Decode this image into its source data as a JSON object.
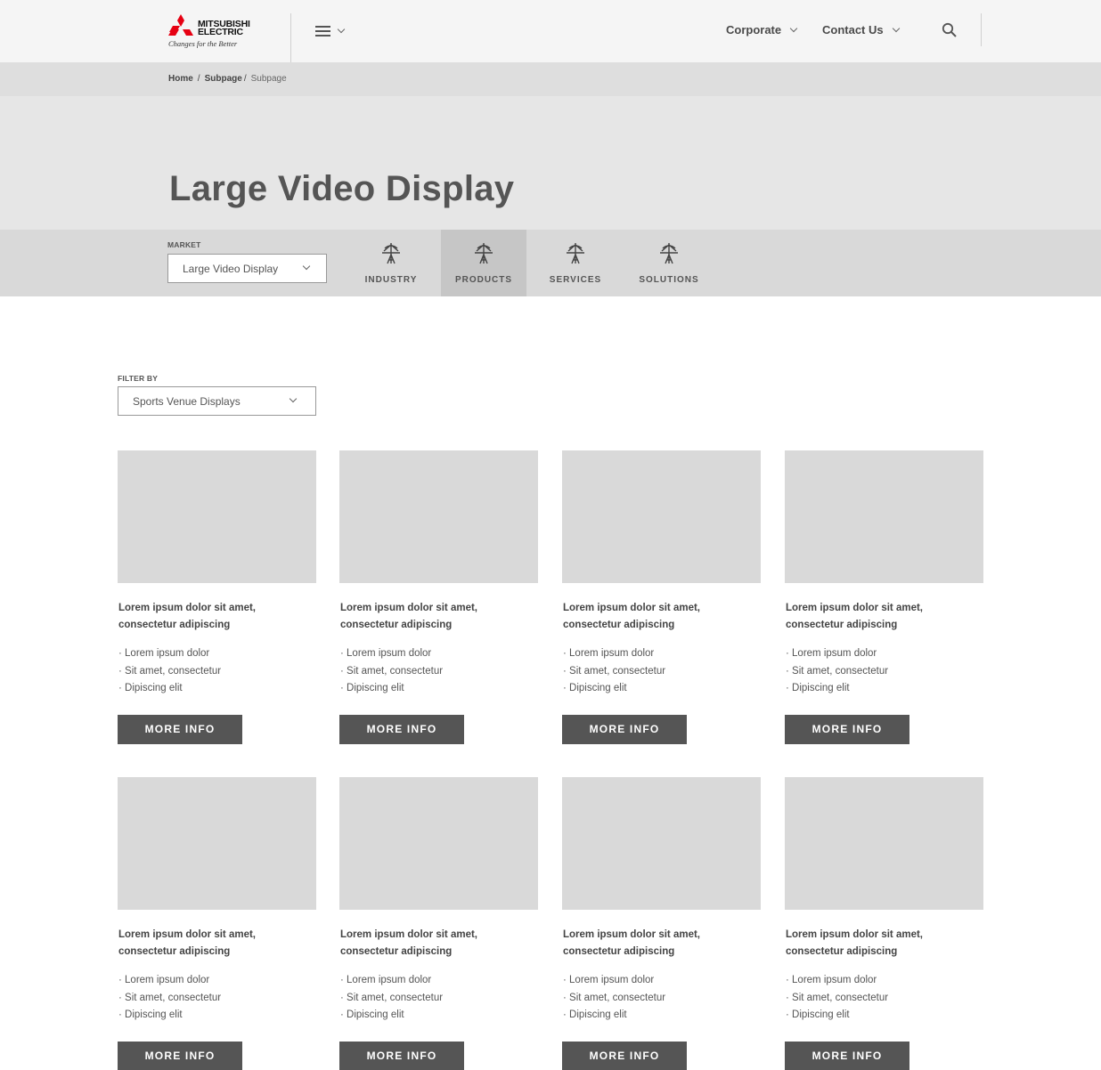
{
  "header": {
    "logo": {
      "brand_line1": "MITSUBISHI",
      "brand_line2": "ELECTRIC",
      "tagline": "Changes for the Better",
      "mark_color": "#e60012"
    },
    "menu_icon": "hamburger-icon",
    "nav": [
      {
        "label": "Corporate"
      },
      {
        "label": "Contact Us"
      }
    ],
    "search_icon": "search-icon"
  },
  "breadcrumb": {
    "items": [
      "Home",
      "Subpage"
    ],
    "current": "Subpage",
    "separator": "/"
  },
  "hero": {
    "title": "Large Video Display"
  },
  "market": {
    "label": "MARKET",
    "selected": "Large Video Display",
    "tabs": [
      {
        "label": "INDUSTRY",
        "icon": "tower-icon",
        "active": false
      },
      {
        "label": "PRODUCTS",
        "icon": "tower-icon",
        "active": true
      },
      {
        "label": "SERVICES",
        "icon": "tower-icon",
        "active": false
      },
      {
        "label": "SOLUTIONS",
        "icon": "tower-icon",
        "active": false
      }
    ]
  },
  "filter": {
    "label": "FILTER BY",
    "selected": "Sports Venue Displays"
  },
  "cards": [
    {
      "title_line1": "Lorem ipsum dolor sit amet,",
      "title_line2": "consectetur adipiscing",
      "bullets": [
        "Lorem ipsum dolor",
        "Sit amet, consectetur",
        "Dipiscing elit"
      ],
      "button": "MORE INFO"
    },
    {
      "title_line1": "Lorem ipsum dolor sit amet,",
      "title_line2": "consectetur adipiscing",
      "bullets": [
        "Lorem ipsum dolor",
        "Sit amet, consectetur",
        "Dipiscing elit"
      ],
      "button": "MORE INFO"
    },
    {
      "title_line1": "Lorem ipsum dolor sit amet,",
      "title_line2": "consectetur adipiscing",
      "bullets": [
        "Lorem ipsum dolor",
        "Sit amet, consectetur",
        "Dipiscing elit"
      ],
      "button": "MORE INFO"
    },
    {
      "title_line1": "Lorem ipsum dolor sit amet,",
      "title_line2": "consectetur adipiscing",
      "bullets": [
        "Lorem ipsum dolor",
        "Sit amet, consectetur",
        "Dipiscing elit"
      ],
      "button": "MORE INFO"
    },
    {
      "title_line1": "Lorem ipsum dolor sit amet,",
      "title_line2": "consectetur adipiscing",
      "bullets": [
        "Lorem ipsum dolor",
        "Sit amet, consectetur",
        "Dipiscing elit"
      ],
      "button": "MORE INFO"
    },
    {
      "title_line1": "Lorem ipsum dolor sit amet,",
      "title_line2": "consectetur adipiscing",
      "bullets": [
        "Lorem ipsum dolor",
        "Sit amet, consectetur",
        "Dipiscing elit"
      ],
      "button": "MORE INFO"
    },
    {
      "title_line1": "Lorem ipsum dolor sit amet,",
      "title_line2": "consectetur adipiscing",
      "bullets": [
        "Lorem ipsum dolor",
        "Sit amet, consectetur",
        "Dipiscing elit"
      ],
      "button": "MORE INFO"
    },
    {
      "title_line1": "Lorem ipsum dolor sit amet,",
      "title_line2": "consectetur adipiscing",
      "bullets": [
        "Lorem ipsum dolor",
        "Sit amet, consectetur",
        "Dipiscing elit"
      ],
      "button": "MORE INFO"
    }
  ]
}
